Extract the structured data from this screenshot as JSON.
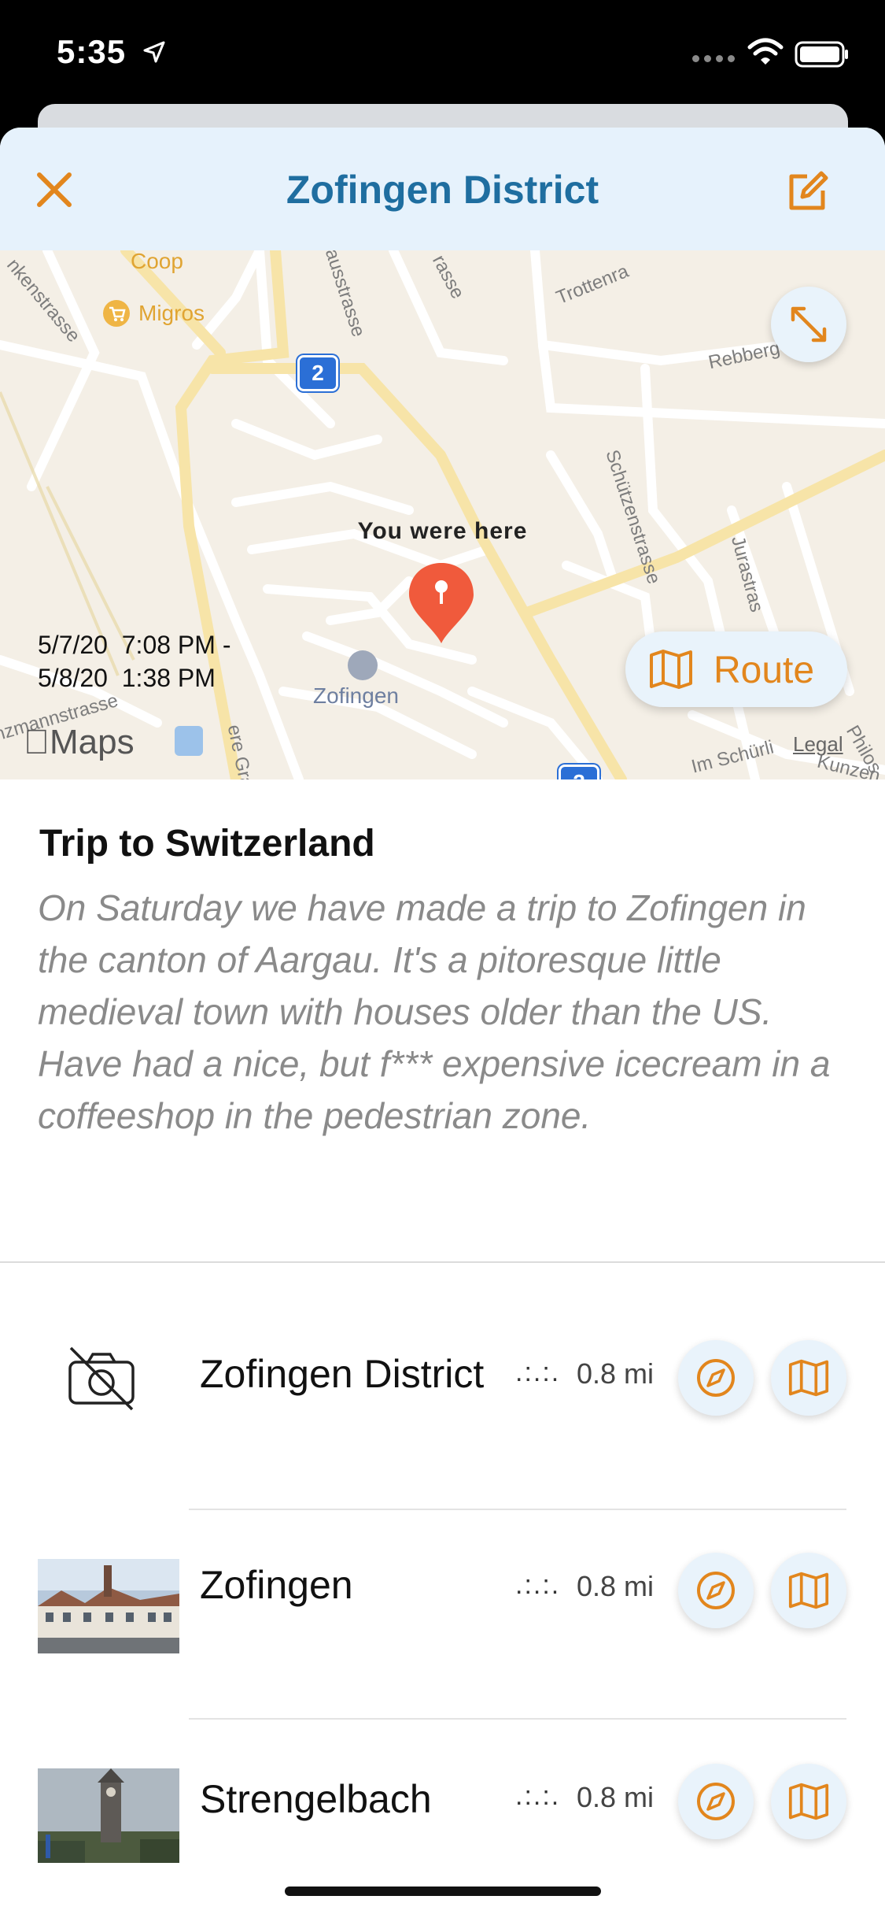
{
  "status": {
    "time": "5:35"
  },
  "nav": {
    "title": "Zofingen District"
  },
  "map": {
    "pin_label": "You were here",
    "dates": "5/7/20  7:08 PM -\n5/8/20  1:38 PM",
    "route_label": "Route",
    "maps_brand": "Maps",
    "legal": "Legal",
    "pois": {
      "coop": "Coop",
      "migros": "Migros",
      "zofingen": "Zofingen"
    },
    "road_number": "2",
    "streets": {
      "s1": "nkenstrasse",
      "s2": "ausstrasse",
      "s3": "rasse",
      "s4": "Trottenra",
      "s5": "Rebberg",
      "s6": "Schützenstrasse",
      "s7": "Jurastras",
      "s8": "nzmannstrasse",
      "s9": "ere Grabe",
      "s10": "Philos",
      "s11": "Im Schürli",
      "s12": "Kunzen"
    }
  },
  "trip": {
    "title": "Trip to Switzerland",
    "description": "On Saturday we have made a trip to Zofingen in the canton of Aargau. It's a pitoresque little medieval town with houses older than the US. Have had a nice, but f*** expensive icecream in a coffeeshop in the pedestrian zone."
  },
  "places": [
    {
      "name": "Zofingen District",
      "dots": ".:.:.",
      "distance": "0.8 mi",
      "photo": "no-photo"
    },
    {
      "name": "Zofingen",
      "dots": ".:.:.",
      "distance": "0.8 mi",
      "photo": "town-photo"
    },
    {
      "name": "Strengelbach",
      "dots": ".:.:.",
      "distance": "0.8 mi",
      "photo": "tower-photo"
    }
  ],
  "colors": {
    "accent": "#e2861d",
    "title_blue": "#1f6ea0",
    "nav_bg": "#e6f2fc",
    "pin_red": "#f05a3c"
  }
}
